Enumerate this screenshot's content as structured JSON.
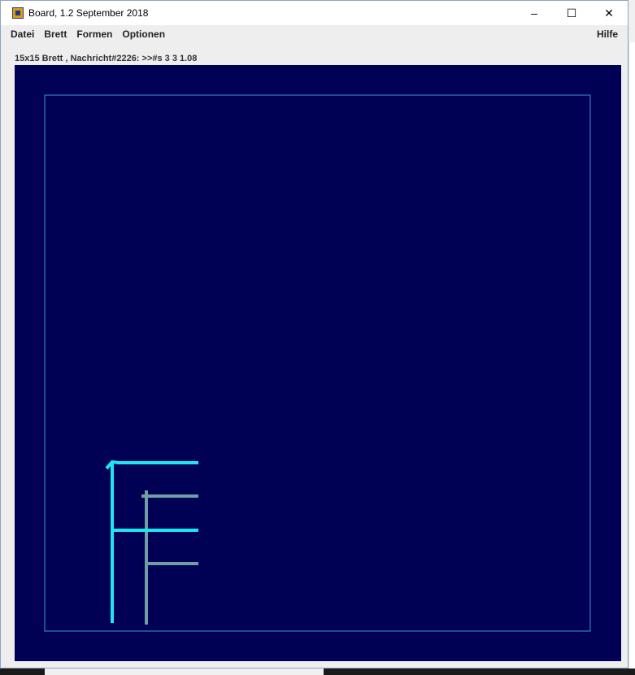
{
  "window": {
    "title": "Board, 1.2 September 2018",
    "app_icon": "board-app-icon",
    "controls": {
      "minimize": "–",
      "maximize": "☐",
      "close": "✕"
    }
  },
  "menu": {
    "items": [
      "Datei",
      "Brett",
      "Formen",
      "Optionen"
    ],
    "help": "Hilfe"
  },
  "status": {
    "text": "15x15 Brett , Nachricht#2226: >>#s 3 3 1.08"
  },
  "board": {
    "background": "#000055",
    "frame_color": "#3a9ad6",
    "primary_color": "#1ee6f0",
    "secondary_color": "#6f9ea4"
  }
}
